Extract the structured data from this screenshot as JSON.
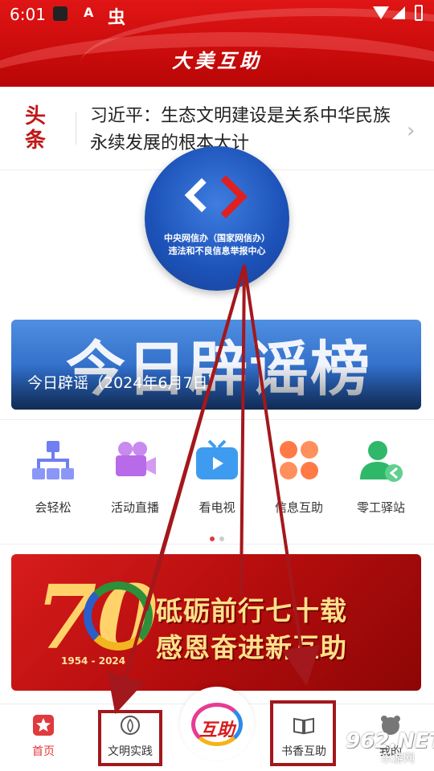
{
  "status_bar": {
    "time": "6:01",
    "app_label": "A",
    "bug_glyph": "虫"
  },
  "header": {
    "title": "大美互助"
  },
  "headline": {
    "tag": "头条",
    "text": "习近平：生态文明建设是关系中华民族永续发展的根本大计"
  },
  "badge": {
    "line1": "中央网信办（国家网信办）",
    "line2": "违法和不良信息举报中心"
  },
  "debunk_banner": {
    "big_text": "今日辟谣榜",
    "caption": "今日辟谣（2024年6月7日）"
  },
  "grid": {
    "items": [
      {
        "label": "会轻松",
        "icon": "org-chart-icon",
        "color": "#6f7ef3"
      },
      {
        "label": "活动直播",
        "icon": "video-camera-icon",
        "color": "#b76be8"
      },
      {
        "label": "看电视",
        "icon": "tv-icon",
        "color": "#3d9cf0"
      },
      {
        "label": "信息互助",
        "icon": "clover-icon",
        "color": "#ff7a45"
      },
      {
        "label": "零工驿站",
        "icon": "user-return-icon",
        "color": "#2fb86a"
      }
    ],
    "page_count": 2,
    "active_page": 1
  },
  "anniversary_banner": {
    "number": "70",
    "years": "1954 - 2024",
    "slogan_line1": "砥砺前行七十载",
    "slogan_line2": "感恩奋进新互助"
  },
  "tabbar": {
    "tabs": [
      {
        "label": "首页",
        "icon": "home-star-icon",
        "active": true
      },
      {
        "label": "文明实践",
        "icon": "civilization-icon",
        "active": false
      },
      {
        "label": "互助",
        "icon": "huzhu-logo-icon",
        "active": false
      },
      {
        "label": "书香互助",
        "icon": "book-icon",
        "active": false
      },
      {
        "label": "我的",
        "icon": "user-bear-icon",
        "active": false
      }
    ]
  },
  "watermark": {
    "text": "962.NET",
    "sub": "乐游网"
  },
  "colors": {
    "brand_red": "#cc0c0c",
    "annotation_red": "#a3181c",
    "active_tab": "#e0393e"
  }
}
